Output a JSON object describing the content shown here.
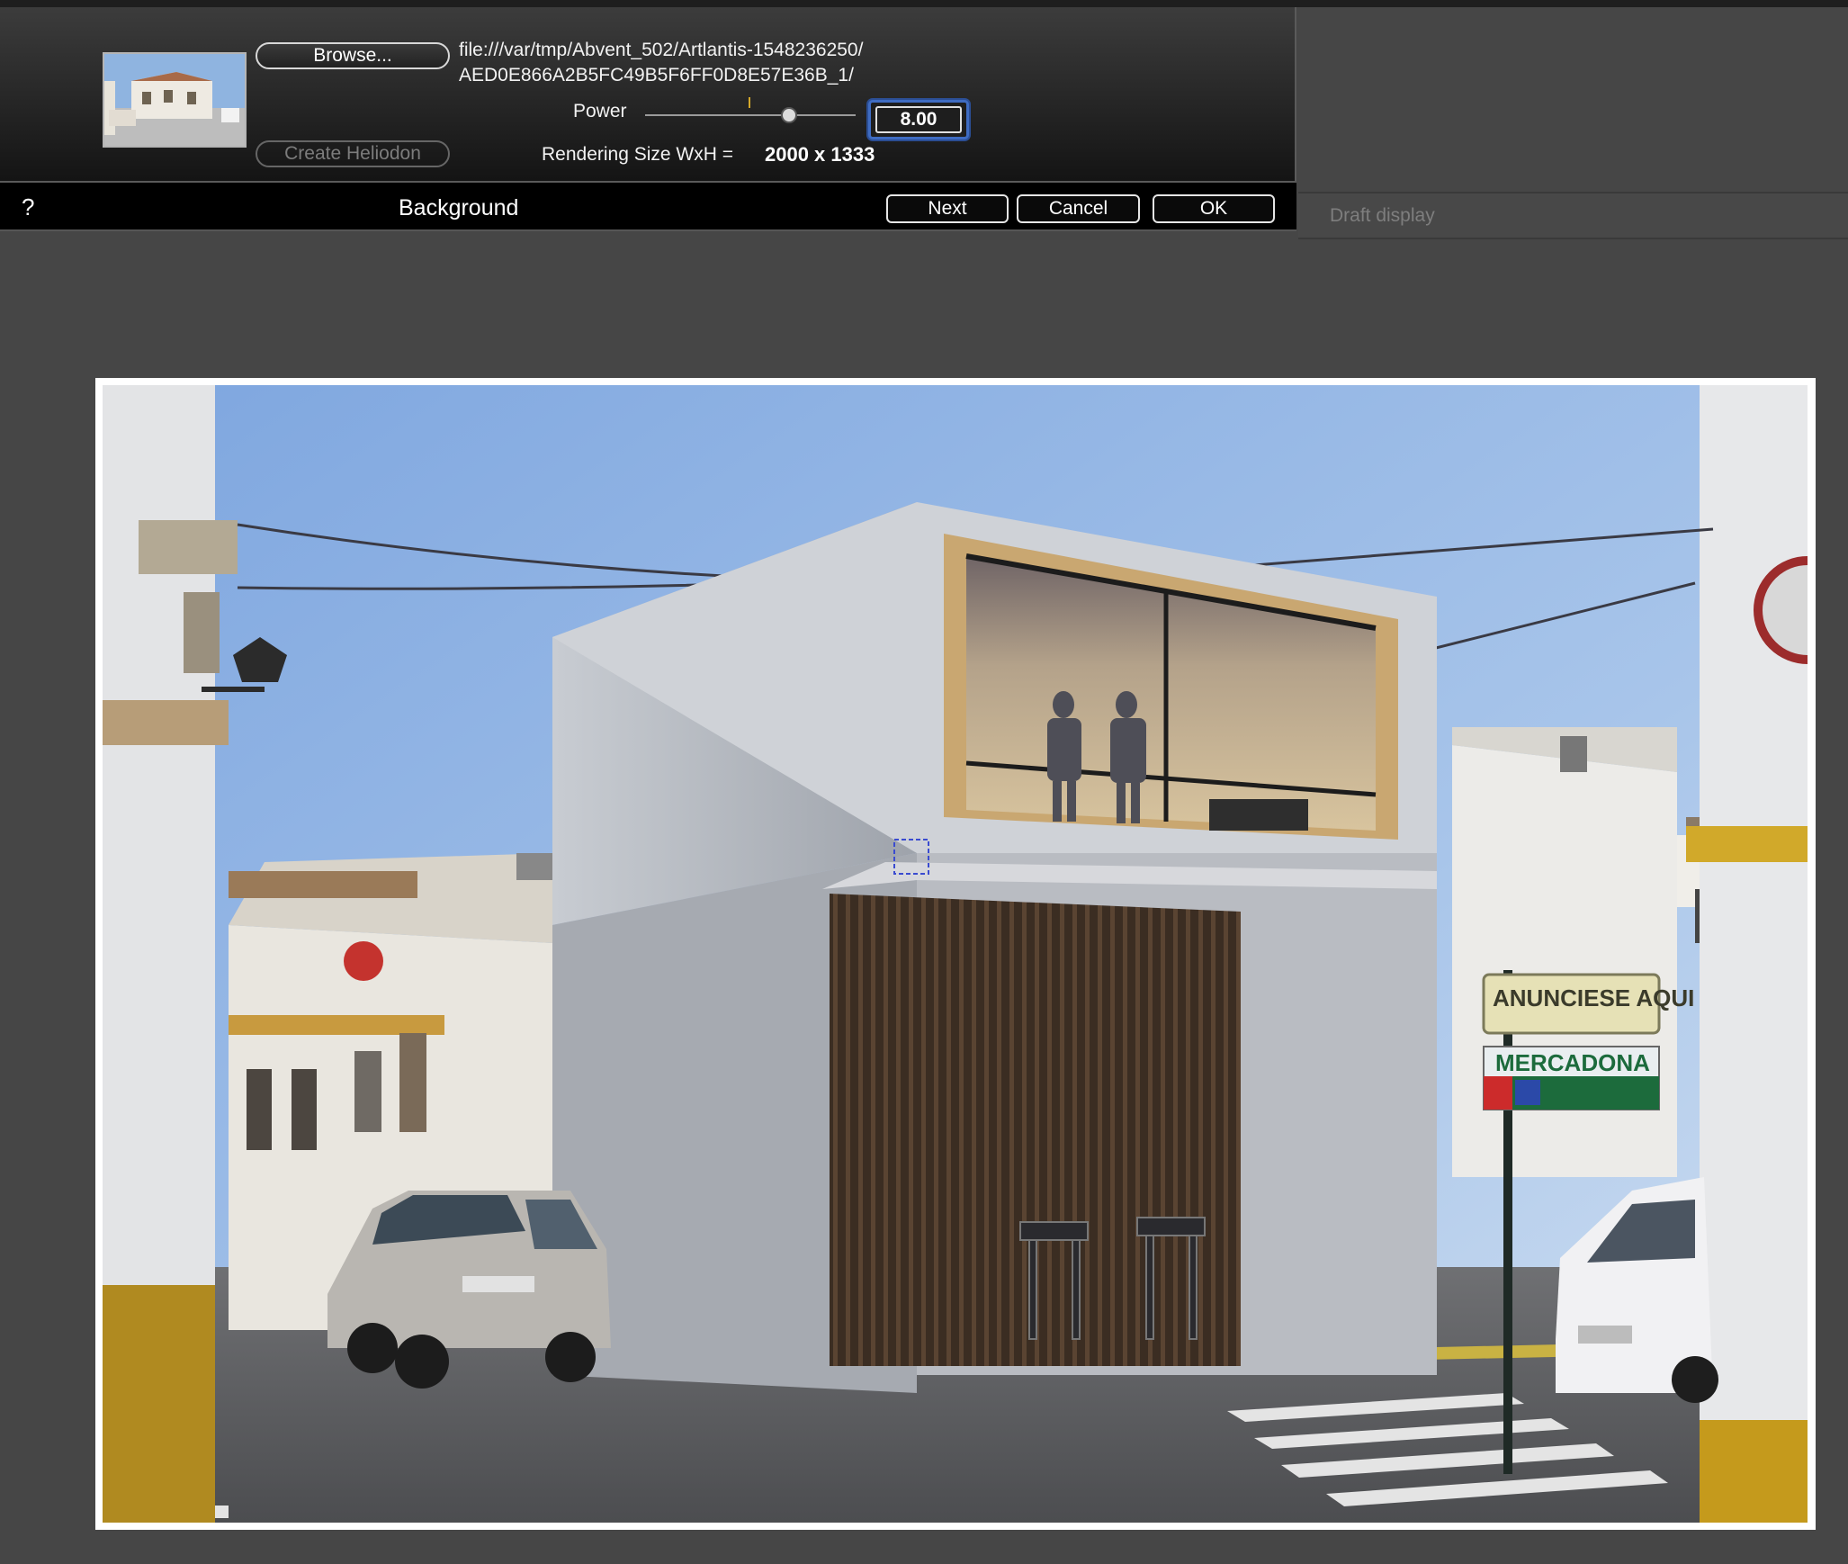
{
  "dialog": {
    "browse_label": "Browse...",
    "create_heliodon_label": "Create Heliodon",
    "file_path_line1": "file:///var/tmp/Abvent_502/Artlantis-1548236250/",
    "file_path_line2": "AED0E866A2B5FC49B5F6FF0D8E57E36B_1/",
    "power_label": "Power",
    "power_value": "8.00",
    "power_level": 0.7,
    "rendering_size_label": "Rendering Size WxH =",
    "rendering_size_value": "2000 x 1333"
  },
  "bottom_bar": {
    "help_label": "?",
    "title": "Background",
    "next_label": "Next",
    "cancel_label": "Cancel",
    "ok_label": "OK"
  },
  "right_panel": {
    "draft_display_label": "Draft display"
  },
  "preview": {
    "signs": {
      "sign1_line1": "ANUNCIESE AQUI",
      "sign2": "MERCADONA"
    }
  },
  "colors": {
    "accent_focus": "#3f6cc2",
    "slider_marker": "#d4a82a",
    "background": "#464646"
  }
}
